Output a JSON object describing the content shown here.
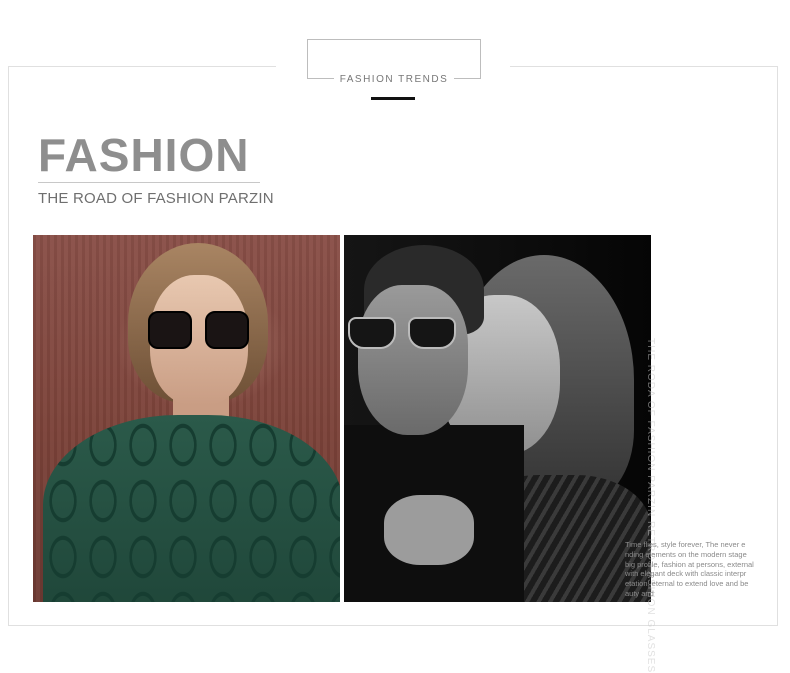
{
  "badge": {
    "label": "FASHION TRENDS"
  },
  "headline": {
    "title": "FASHION",
    "subtitle": "THE ROAD OF FASHION PARZIN"
  },
  "photos": {
    "left_alt": "Woman in square sunglasses wearing green lattice dress",
    "right_alt": "Couple in aviator sunglasses, black and white"
  },
  "vertical_text": {
    "line1": "THE RODA OF FASHION PARZIN",
    "line2": "RETRO FASHION GLASSES"
  },
  "caption": {
    "lines": [
      "Time flies, style forever, The never e",
      "nding elements on the modern stage",
      "big profile, fashion at persons, external",
      "with elegant deck with classic interpr",
      "etation, eternal to extend love and be",
      "auty and"
    ]
  },
  "colors": {
    "accent": "#111111",
    "headline": "#8e8e8e",
    "dress": "#1f4639",
    "backdrop": "#7b4239"
  }
}
